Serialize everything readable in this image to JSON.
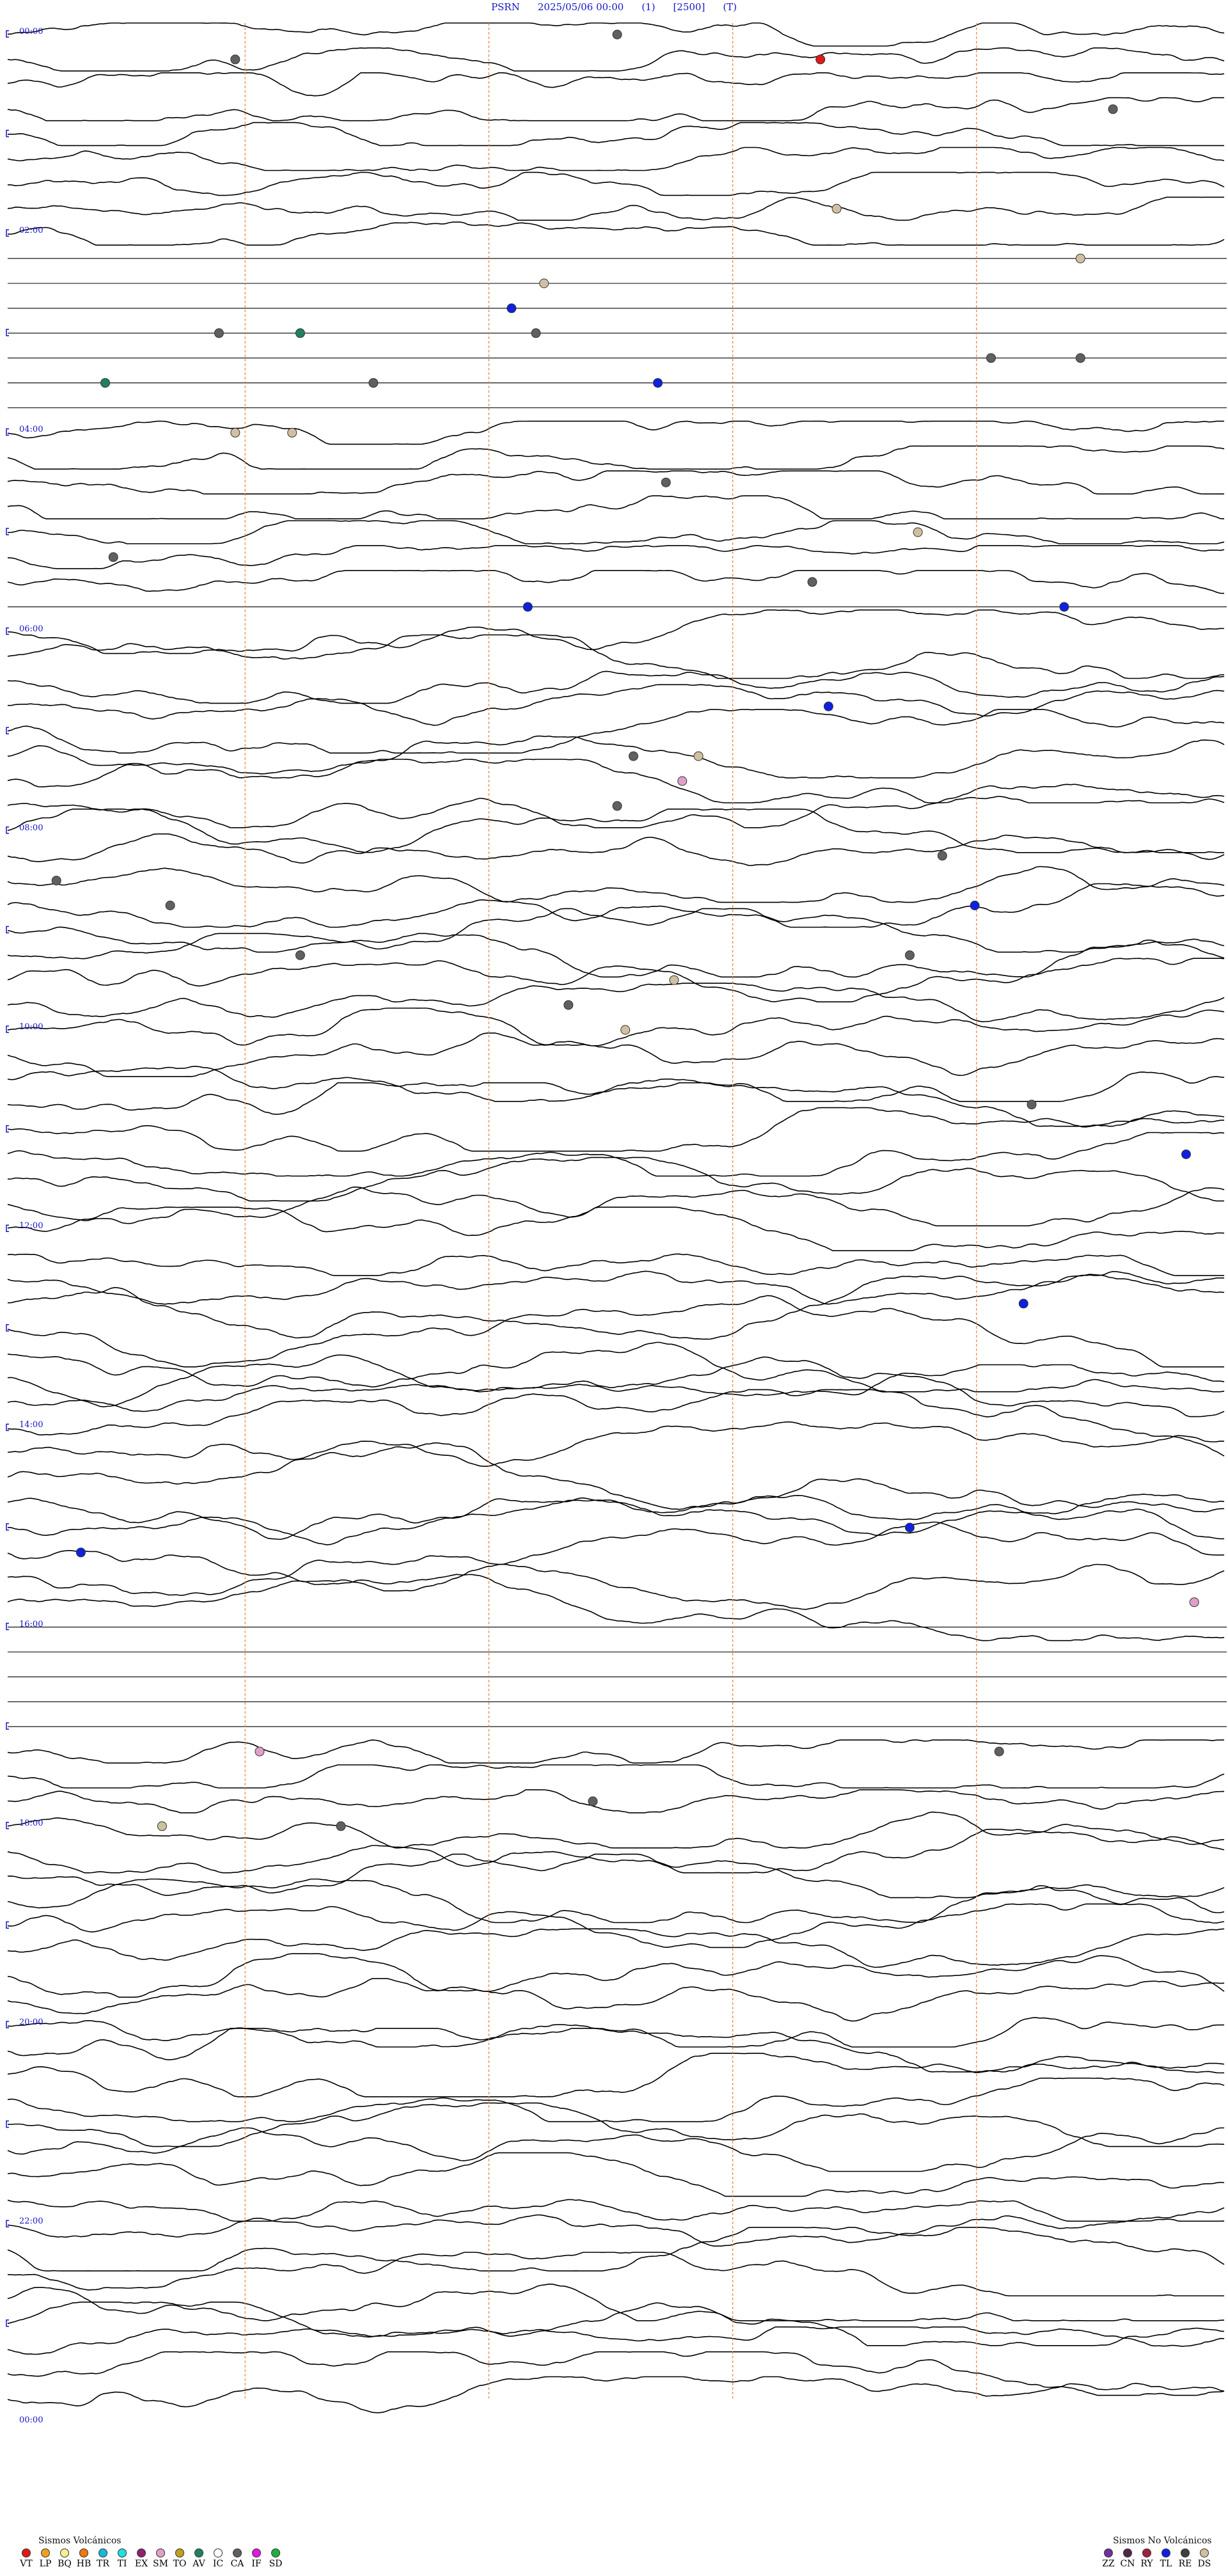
{
  "header": {
    "station": "PSRN",
    "datetime": "2025/05/06 00:00",
    "code1": "(1)",
    "code2": "[2500]",
    "code3": "(T)"
  },
  "chart_data": {
    "type": "helicorder",
    "hour_labels": [
      "00:00",
      "02:00",
      "04:00",
      "06:00",
      "08:00",
      "10:00",
      "12:00",
      "14:00",
      "16:00",
      "18:00",
      "20:00",
      "22:00",
      "00:00"
    ],
    "trace_rows": 96,
    "minutes_per_row": 15,
    "active_segments": [
      {
        "from_row": 0,
        "to_row": 8,
        "amplitude": "low"
      },
      {
        "from_row": 16,
        "to_row": 22,
        "amplitude": "low"
      },
      {
        "from_row": 24,
        "to_row": 60,
        "amplitude": "medium"
      },
      {
        "from_row": 50,
        "to_row": 63,
        "amplitude": "high"
      },
      {
        "from_row": 69,
        "to_row": 75,
        "amplitude": "low"
      },
      {
        "from_row": 72,
        "to_row": 96,
        "amplitude": "medium"
      }
    ],
    "events": [
      {
        "row": 1,
        "minute": 2.8,
        "type": "CA"
      },
      {
        "row": 0,
        "minute": 7.5,
        "type": "CA"
      },
      {
        "row": 1,
        "minute": 10.0,
        "type": "VT"
      },
      {
        "row": 3,
        "minute": 13.6,
        "type": "CA"
      },
      {
        "row": 7,
        "minute": 10.2,
        "type": "DS"
      },
      {
        "row": 9,
        "minute": 13.2,
        "type": "DS"
      },
      {
        "row": 10,
        "minute": 6.6,
        "type": "DS"
      },
      {
        "row": 11,
        "minute": 6.2,
        "type": "TL"
      },
      {
        "row": 12,
        "minute": 2.6,
        "type": "CA"
      },
      {
        "row": 12,
        "minute": 3.6,
        "type": "AV"
      },
      {
        "row": 12,
        "minute": 6.5,
        "type": "CA"
      },
      {
        "row": 13,
        "minute": 13.2,
        "type": "CA"
      },
      {
        "row": 13,
        "minute": 12.1,
        "type": "CA"
      },
      {
        "row": 14,
        "minute": 1.2,
        "type": "AV"
      },
      {
        "row": 14,
        "minute": 4.5,
        "type": "CA"
      },
      {
        "row": 14,
        "minute": 8.0,
        "type": "TL"
      },
      {
        "row": 16,
        "minute": 2.8,
        "type": "DS"
      },
      {
        "row": 16,
        "minute": 3.5,
        "type": "DS"
      },
      {
        "row": 18,
        "minute": 8.1,
        "type": "CA"
      },
      {
        "row": 20,
        "minute": 11.2,
        "type": "DS"
      },
      {
        "row": 21,
        "minute": 1.3,
        "type": "CA"
      },
      {
        "row": 22,
        "minute": 9.9,
        "type": "CA"
      },
      {
        "row": 23,
        "minute": 6.4,
        "type": "TL"
      },
      {
        "row": 23,
        "minute": 13.0,
        "type": "TL"
      },
      {
        "row": 27,
        "minute": 10.1,
        "type": "TL"
      },
      {
        "row": 29,
        "minute": 7.7,
        "type": "CA"
      },
      {
        "row": 29,
        "minute": 8.5,
        "type": "DS"
      },
      {
        "row": 30,
        "minute": 8.3,
        "type": "SM"
      },
      {
        "row": 31,
        "minute": 7.5,
        "type": "CA"
      },
      {
        "row": 33,
        "minute": 11.5,
        "type": "CA"
      },
      {
        "row": 34,
        "minute": 0.6,
        "type": "CA"
      },
      {
        "row": 35,
        "minute": 2.0,
        "type": "CA"
      },
      {
        "row": 35,
        "minute": 11.9,
        "type": "TL"
      },
      {
        "row": 37,
        "minute": 3.6,
        "type": "CA"
      },
      {
        "row": 37,
        "minute": 11.1,
        "type": "CA"
      },
      {
        "row": 38,
        "minute": 8.2,
        "type": "DS"
      },
      {
        "row": 39,
        "minute": 6.9,
        "type": "CA"
      },
      {
        "row": 40,
        "minute": 7.6,
        "type": "DS"
      },
      {
        "row": 43,
        "minute": 12.6,
        "type": "CA"
      },
      {
        "row": 45,
        "minute": 14.5,
        "type": "TL"
      },
      {
        "row": 51,
        "minute": 12.5,
        "type": "TL"
      },
      {
        "row": 60,
        "minute": 11.1,
        "type": "TL"
      },
      {
        "row": 61,
        "minute": 0.9,
        "type": "TL"
      },
      {
        "row": 63,
        "minute": 14.6,
        "type": "SM"
      },
      {
        "row": 69,
        "minute": 3.1,
        "type": "SM"
      },
      {
        "row": 69,
        "minute": 12.2,
        "type": "CA"
      },
      {
        "row": 71,
        "minute": 7.2,
        "type": "CA"
      },
      {
        "row": 72,
        "minute": 1.9,
        "type": "DS"
      },
      {
        "row": 72,
        "minute": 4.1,
        "type": "CA"
      }
    ]
  },
  "legend_volcanic": {
    "title": "Sismos Volcánicos",
    "items": [
      {
        "code": "VT",
        "color": "#e01818"
      },
      {
        "code": "LP",
        "color": "#f0a020"
      },
      {
        "code": "BQ",
        "color": "#f4f090"
      },
      {
        "code": "HB",
        "color": "#f07810"
      },
      {
        "code": "TR",
        "color": "#18b8e0"
      },
      {
        "code": "TI",
        "color": "#20e0e0"
      },
      {
        "code": "EX",
        "color": "#902070"
      },
      {
        "code": "SM",
        "color": "#e0a0c8"
      },
      {
        "code": "TO",
        "color": "#c0a020"
      },
      {
        "code": "AV",
        "color": "#208060"
      },
      {
        "code": "IC",
        "color": "#ffffff"
      },
      {
        "code": "CA",
        "color": "#606060"
      },
      {
        "code": "IF",
        "color": "#e018e0"
      },
      {
        "code": "SD",
        "color": "#20b040"
      }
    ]
  },
  "legend_nonvolcanic": {
    "title": "Sismos No Volcánicos",
    "items": [
      {
        "code": "ZZ",
        "color": "#7030a0"
      },
      {
        "code": "CN",
        "color": "#502848"
      },
      {
        "code": "RY",
        "color": "#a02040"
      },
      {
        "code": "TL",
        "color": "#1020e0"
      },
      {
        "code": "RE",
        "color": "#404040"
      },
      {
        "code": "DS",
        "color": "#d0c0a0"
      }
    ]
  }
}
